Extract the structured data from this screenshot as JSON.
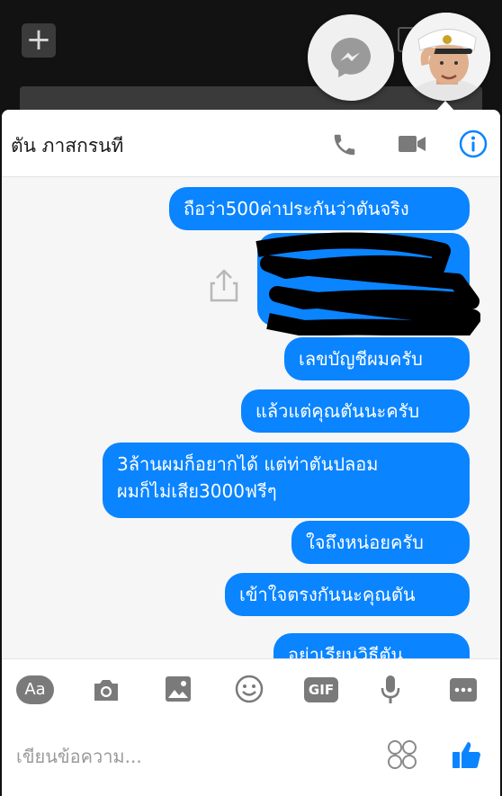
{
  "header": {
    "contact_name": "ตัน ภาสกรนที"
  },
  "messages": [
    {
      "text": "ถือว่า500ค่าประกันว่าตันจริง"
    },
    {
      "text": "เลขบัญชีผมครับ"
    },
    {
      "text": "แล้วแต่คุณตันนะครับ"
    },
    {
      "line1": "3ล้านผมก็อยากได้ แต่ท่าตันปลอม",
      "line2": "ผมก็ไม่เสีย3000ฟรีๆ"
    },
    {
      "text": "ใจถึงหน่อยครับ"
    },
    {
      "text": "เข้าใจตรงกันนะคุณตัน"
    },
    {
      "text": "อย่าเรียนวิธีตัน"
    }
  ],
  "toolbar": {
    "aa_label": "Aa",
    "gif_label": "GIF"
  },
  "composer": {
    "placeholder": "เขียนข้อความ..."
  },
  "colors": {
    "bubble": "#0a84ff",
    "accent": "#0a84ff",
    "icon_gray": "#7a7a7a"
  },
  "icons": [
    "plus-icon",
    "messenger-icon",
    "phone-icon",
    "video-icon",
    "info-icon",
    "share-icon",
    "camera-icon",
    "image-icon",
    "emoji-icon",
    "mic-icon",
    "more-icon",
    "sticker-icon",
    "like-icon"
  ]
}
